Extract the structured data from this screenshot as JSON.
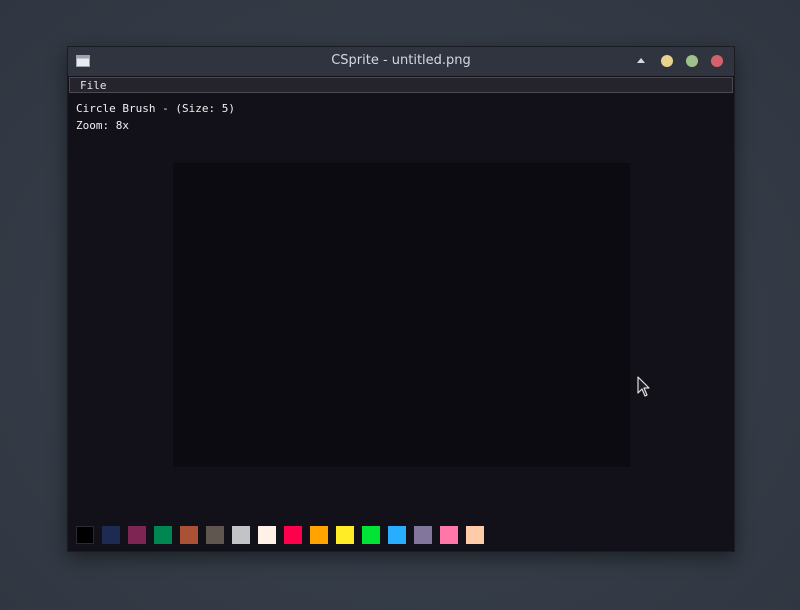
{
  "window": {
    "title": "CSprite - untitled.png",
    "buttons": {
      "minimize_color": "#e9d28e",
      "maximize_color": "#9fc28b",
      "close_color": "#d4626a"
    }
  },
  "menubar": {
    "items": [
      {
        "label": "File"
      }
    ]
  },
  "status": {
    "brush": "Circle Brush - (Size: 5)",
    "zoom": "Zoom: 8x"
  },
  "palette": {
    "colors": [
      "#000000",
      "#1d2b53",
      "#7e2553",
      "#008751",
      "#ab5236",
      "#5f574f",
      "#c2c3c7",
      "#fff1e8",
      "#ff004d",
      "#ffa300",
      "#ffec27",
      "#00e436",
      "#29adff",
      "#83769c",
      "#ff77a8",
      "#ffccaa"
    ]
  },
  "icons": {
    "app": "window-icon",
    "shade": "triangle-up-icon",
    "pointer": "mouse-pointer-icon"
  }
}
